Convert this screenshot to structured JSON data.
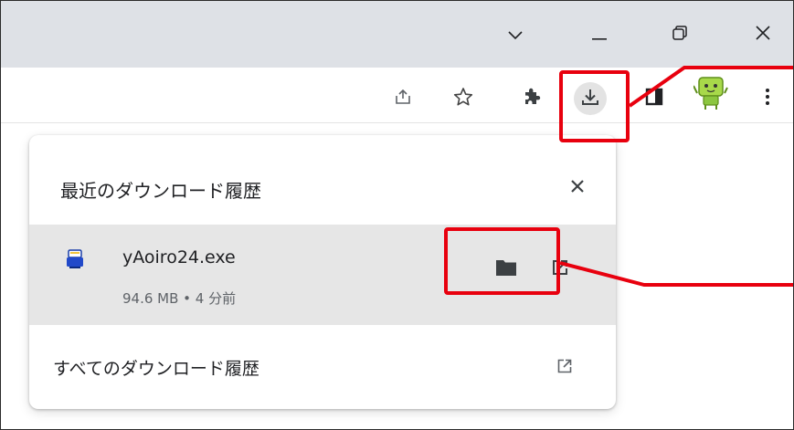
{
  "window": {
    "controls": [
      "chevron-down",
      "minimize",
      "restore",
      "close"
    ]
  },
  "toolbar": {
    "icons": [
      "share-icon",
      "star-icon",
      "extensions-icon",
      "download-icon",
      "side-panel-icon",
      "profile-avatar",
      "menu-icon"
    ]
  },
  "downloads_popup": {
    "title": "最近のダウンロード履歴",
    "items": [
      {
        "name": "yAoiro24.exe",
        "meta": "94.6 MB • 4 分前"
      }
    ],
    "all_history_label": "すべてのダウンロード履歴"
  },
  "colors": {
    "titlebar": "#dee1e6",
    "highlight": "#e8000e",
    "row_bg": "#e6e6e6"
  }
}
